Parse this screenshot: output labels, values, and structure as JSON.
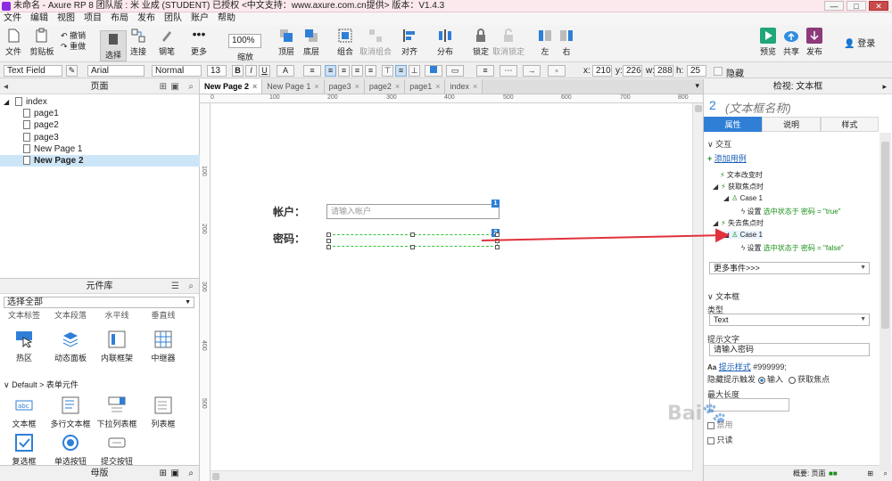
{
  "window": {
    "title": "未命名 - Axure RP 8 团队版 : 米 业成 (STUDENT) 已授权    <中文支持：www.axure.com.cn提供> 版本：V1.4.3",
    "controls": [
      "—",
      "□",
      "✕"
    ]
  },
  "menu": [
    "文件",
    "编辑",
    "视图",
    "项目",
    "布局",
    "发布",
    "团队",
    "账户",
    "帮助"
  ],
  "toolbar": {
    "file": "文件",
    "clipboard": "剪贴板",
    "undo": "撤销",
    "redo": "重做",
    "select": "选择",
    "connect": "连接",
    "pen": "钢笔",
    "more": "更多",
    "zoom_value": "100%",
    "zoom": "缩放",
    "top": "顶层",
    "bottom": "底层",
    "group": "组合",
    "ungroup": "取消组合",
    "align": "对齐",
    "distribute": "分布",
    "lock": "锁定",
    "unlock": "取消锁定",
    "left": "左",
    "right": "右",
    "preview": "预览",
    "share": "共享",
    "publish": "发布",
    "login": "登录"
  },
  "format": {
    "widget_type": "Text Field",
    "font": "Arial",
    "weight": "Normal",
    "size": "13",
    "x_label": "x:",
    "x": "210",
    "y_label": "y:",
    "y": "226",
    "w_label": "w:",
    "w": "288",
    "h_label": "h:",
    "h": "25",
    "hidden": "隐藏"
  },
  "pages": {
    "title": "页面",
    "items": [
      {
        "label": "index"
      },
      {
        "label": "page1"
      },
      {
        "label": "page2"
      },
      {
        "label": "page3"
      },
      {
        "label": "New Page 1"
      },
      {
        "label": "New Page 2"
      }
    ]
  },
  "library": {
    "title": "元件库",
    "select": "选择全部",
    "partial_labels": [
      "文本标签",
      "文本段落",
      "水平线",
      "垂直线"
    ],
    "row1": [
      "热区",
      "动态面板",
      "内联框架",
      "中继器"
    ],
    "section": "Default > 表单元件",
    "row2": [
      "文本框",
      "多行文本框",
      "下拉列表框",
      "列表框"
    ],
    "row3": [
      "复选框",
      "单选按钮",
      "提交按钮"
    ]
  },
  "masters": {
    "title": "母版"
  },
  "tabs": [
    {
      "label": "New Page 2",
      "close": "×"
    },
    {
      "label": "New Page 1",
      "close": "×"
    },
    {
      "label": "page3",
      "close": "×"
    },
    {
      "label": "page2",
      "close": "×"
    },
    {
      "label": "page1",
      "close": "×"
    },
    {
      "label": "index",
      "close": "×"
    }
  ],
  "ruler": {
    "h_ticks": [
      "0",
      "100",
      "200",
      "300",
      "400",
      "500",
      "600",
      "700",
      "800"
    ],
    "v_ticks": [
      "100",
      "200",
      "300",
      "400",
      "500"
    ]
  },
  "canvas": {
    "account_label": "帐户：",
    "account_placeholder": "请输入帐户",
    "account_badge": "1",
    "password_label": "密码：",
    "password_badge": "2"
  },
  "inspector": {
    "title": "检视: 文本框",
    "number": "2",
    "name_placeholder": "(文本框名称)",
    "tabs": [
      "属性",
      "说明",
      "样式"
    ],
    "interaction": "交互",
    "add_case": "添加用例",
    "events": [
      {
        "label": "文本改变时"
      },
      {
        "label": "获取焦点时"
      },
      {
        "label": "Case 1"
      },
      {
        "action": "设置",
        "detail": "选中状态于 密码 = \"true\""
      },
      {
        "label": "失去焦点时"
      },
      {
        "label": "Case 1"
      },
      {
        "action": "设置",
        "detail": "选中状态于 密码 = \"false\""
      }
    ],
    "more_events": "更多事件>>>",
    "textfield_section": "文本框",
    "type_label": "类型",
    "type_value": "Text",
    "hint_label": "提示文字",
    "hint_value": "请输入密码",
    "hint_style_link": "提示样式",
    "hint_color": "#999999;",
    "hide_hint_label": "隐藏提示触发",
    "hide_on_input": "输入",
    "hide_on_focus": "获取焦点",
    "maxlen_label": "最大长度",
    "disabled_label": "禁用",
    "readonly_label": "只读",
    "footer_label": "概要: 页面",
    "accent": "#2f7fd6"
  },
  "colors": {
    "arrow": "#e0323c",
    "selection": "#3bbf3b",
    "badge": "#2f7fd6"
  }
}
